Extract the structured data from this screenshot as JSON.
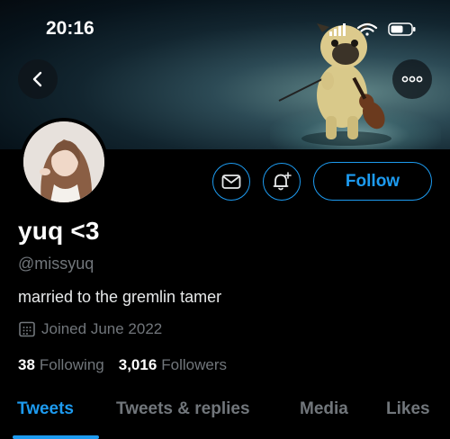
{
  "status_bar": {
    "time": "20:16",
    "icons": [
      "signal-icon",
      "wifi-icon",
      "battery-icon"
    ]
  },
  "header": {
    "back_icon": "chevron-left-icon",
    "more_icon": "more-horizontal-icon"
  },
  "profile": {
    "display_name": "yuq <3",
    "handle": "@missyuq",
    "bio": "married to the gremlin tamer",
    "joined": "Joined June 2022",
    "following_count": "38",
    "following_label": "Following",
    "followers_count": "3,016",
    "followers_label": "Followers"
  },
  "actions": {
    "message_icon": "mail-icon",
    "notify_icon": "bell-plus-icon",
    "follow_label": "Follow"
  },
  "tabs": [
    {
      "label": "Tweets",
      "active": true
    },
    {
      "label": "Tweets & replies",
      "active": false
    },
    {
      "label": "Media",
      "active": false
    },
    {
      "label": "Likes",
      "active": false
    }
  ],
  "colors": {
    "accent": "#1d9bf0",
    "background": "#000000",
    "secondary_text": "#71767b"
  }
}
